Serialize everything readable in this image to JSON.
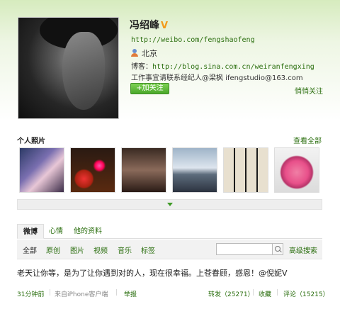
{
  "profile": {
    "name": "冯绍峰",
    "verified_mark": "V",
    "weibo_url": "http://weibo.com/fengshaofeng",
    "location": "北京",
    "blog_label": "博客：",
    "blog_url": "http://blog.sina.com.cn/weiranfengxing",
    "contact": "工作事宜请联系经纪人@梁枫 ifengstudio@163.com",
    "follow_button": "+加关注",
    "quiet_follow": "悄悄关注"
  },
  "photos": {
    "title": "个人照片",
    "view_all": "查看全部",
    "count": 6
  },
  "tabs": [
    "微博",
    "心情",
    "他的资料"
  ],
  "filters": [
    "全部",
    "原创",
    "图片",
    "视频",
    "音乐",
    "标签"
  ],
  "search": {
    "placeholder": "",
    "advanced": "高级搜索"
  },
  "post": {
    "text": "老天让你等，是为了让你遇到对的人，现在很幸福。上苍眷顾，感恩！@倪妮V",
    "time": "31分钟前",
    "source": "来自iPhone客户端",
    "report": "举报",
    "repost": "转发（25271）",
    "favorite": "收藏",
    "comment": "评论（15215）"
  },
  "colors": {
    "link": "#2a6e0e",
    "follow_button": "#4aa82a",
    "verified": "#f29a1a"
  }
}
